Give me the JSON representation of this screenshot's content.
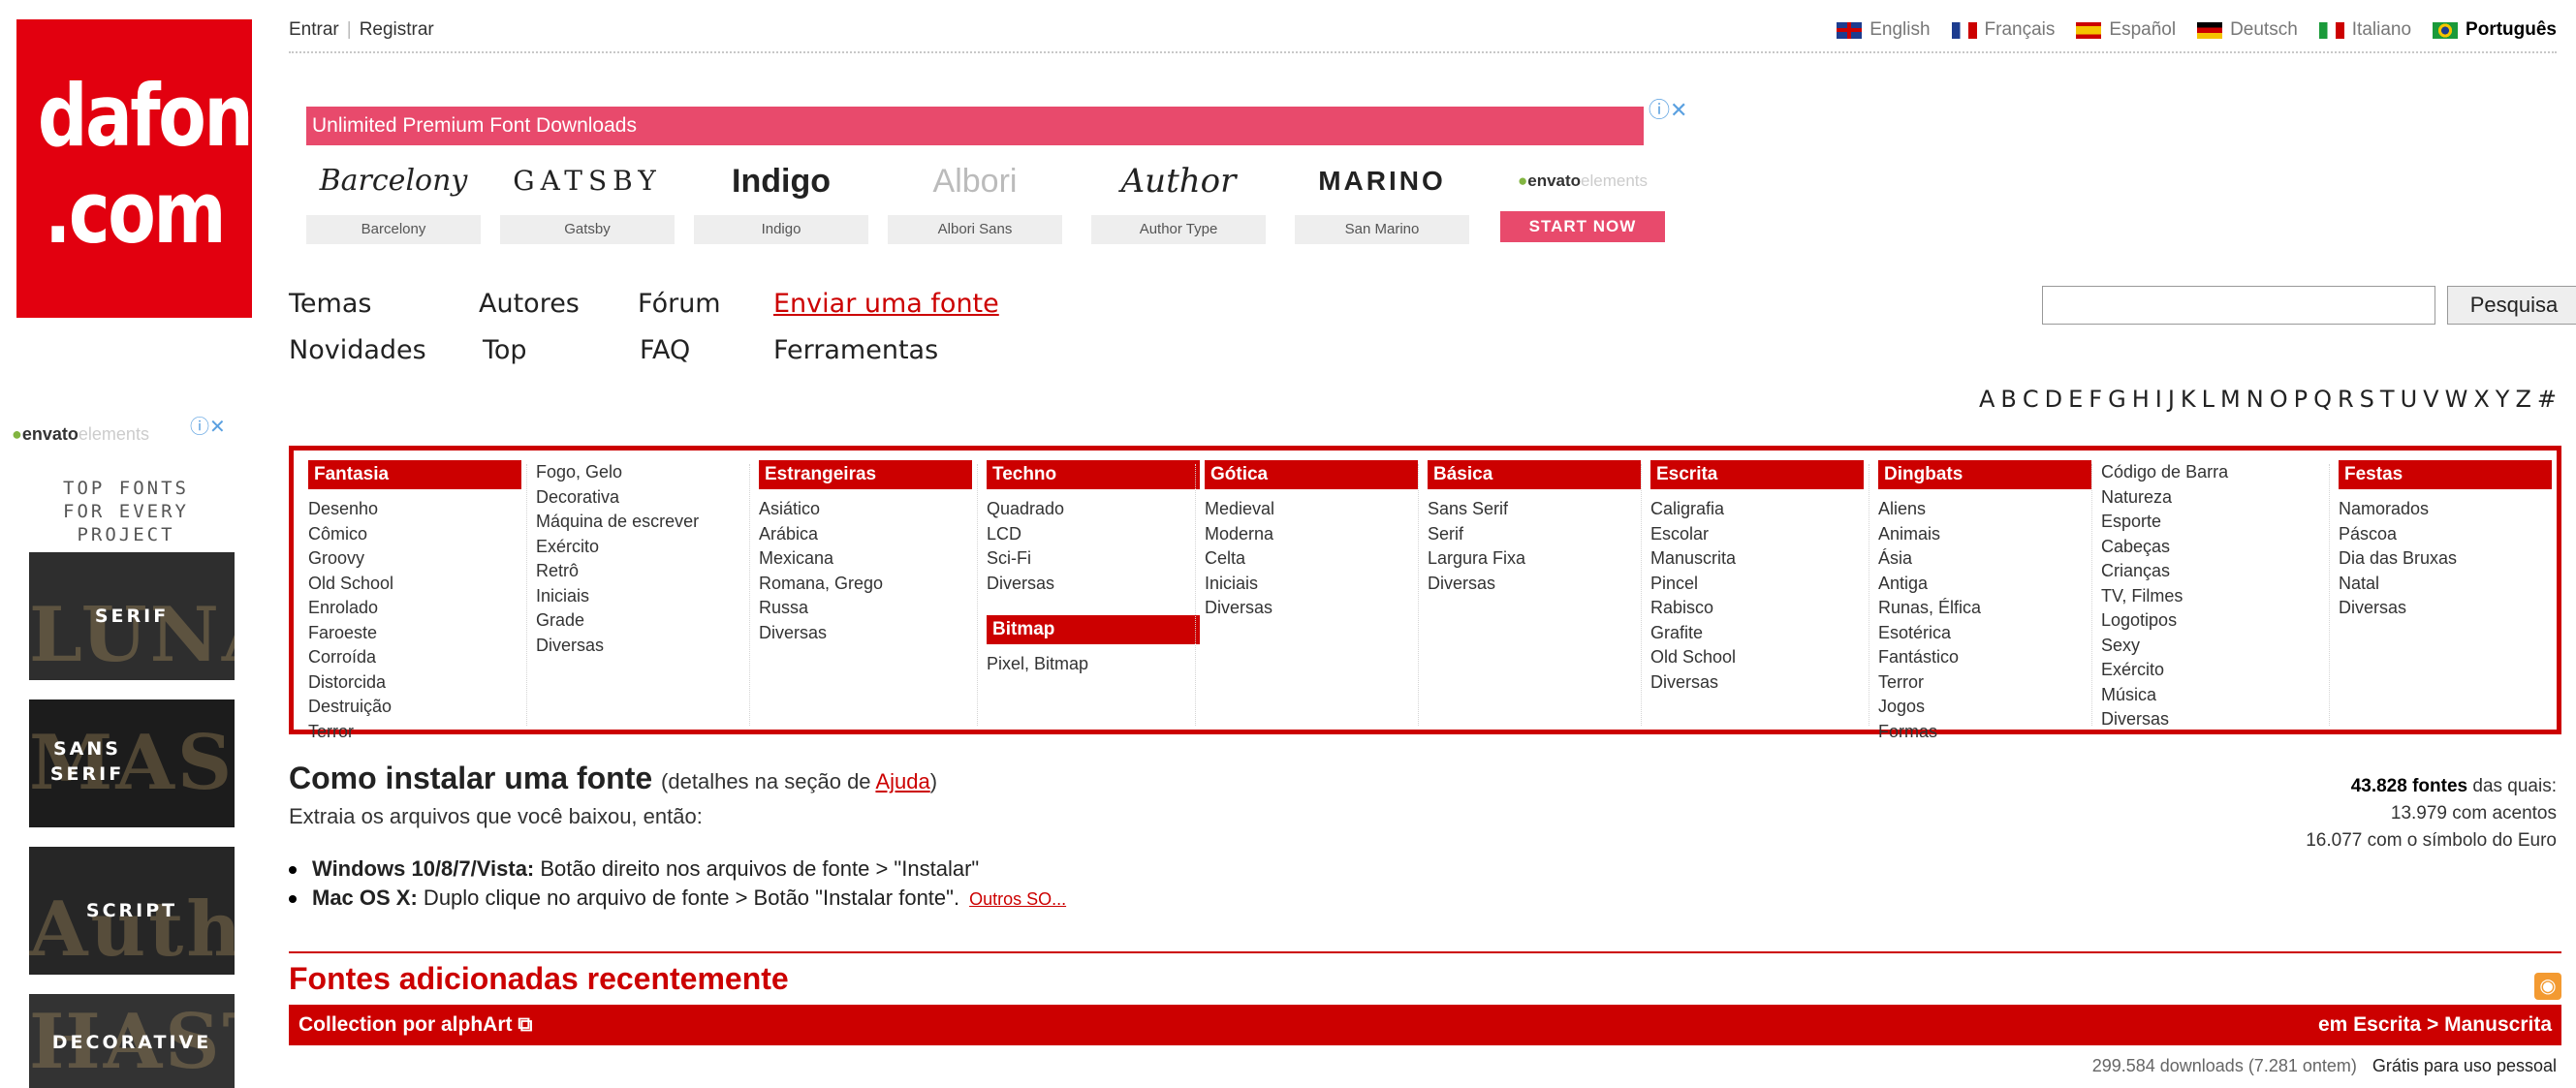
{
  "logo": {
    "line1": "dafont",
    "line2": ".com"
  },
  "side_ad": {
    "brand": "envato",
    "brand_suffix": "elements",
    "headline": [
      "TOP FONTS",
      "FOR EVERY",
      "PROJECT"
    ],
    "tiles": [
      {
        "label": "SERIF",
        "bg": "LUNA",
        "color": "#2e2e2e"
      },
      {
        "label": "SANS SERIF",
        "bg": "MASTER",
        "color": "#1c1c1c"
      },
      {
        "label": "SCRIPT",
        "bg": "Author",
        "color": "#262626"
      },
      {
        "label": "DECORATIVE",
        "bg": "HASTE",
        "color": "#333333"
      }
    ]
  },
  "topbar": {
    "login": "Entrar",
    "register": "Registrar",
    "languages": [
      {
        "label": "English",
        "active": false
      },
      {
        "label": "Français",
        "active": false
      },
      {
        "label": "Español",
        "active": false
      },
      {
        "label": "Deutsch",
        "active": false
      },
      {
        "label": "Italiano",
        "active": false
      },
      {
        "label": "Português",
        "active": true
      }
    ]
  },
  "top_ad": {
    "banner": "Unlimited Premium Font Downloads",
    "fonts": [
      {
        "sample": "Barcelony",
        "name": "Barcelony"
      },
      {
        "sample": "GATSBY",
        "name": "Gatsby"
      },
      {
        "sample": "Indigo",
        "name": "Indigo"
      },
      {
        "sample": "Albori",
        "name": "Albori Sans"
      },
      {
        "sample": "Author",
        "name": "Author Type"
      },
      {
        "sample": "MARINO",
        "name": "San Marino"
      }
    ],
    "brand": "envato",
    "brand_suffix": "elements",
    "cta": "START NOW"
  },
  "nav": {
    "row1": [
      "Temas",
      "Autores",
      "Fórum",
      "Enviar uma fonte"
    ],
    "row2": [
      "Novidades",
      "Top",
      "FAQ",
      "Ferramentas"
    ]
  },
  "search": {
    "button": "Pesquisa",
    "placeholder": ""
  },
  "alphabet": [
    "A",
    "B",
    "C",
    "D",
    "E",
    "F",
    "G",
    "H",
    "I",
    "J",
    "K",
    "L",
    "M",
    "N",
    "O",
    "P",
    "Q",
    "R",
    "S",
    "T",
    "U",
    "V",
    "W",
    "X",
    "Y",
    "Z",
    "#"
  ],
  "categories": [
    {
      "head": "Fantasia",
      "items": [
        "Desenho",
        "Cômico",
        "Groovy",
        "Old School",
        "Enrolado",
        "Faroeste",
        "Corroída",
        "Distorcida",
        "Destruição",
        "Terror"
      ]
    },
    {
      "head": "",
      "items": [
        "Fogo, Gelo",
        "Decorativa",
        "Máquina de escrever",
        "Exército",
        "Retrô",
        "Iniciais",
        "Grade",
        "Diversas"
      ]
    },
    {
      "head": "Estrangeiras",
      "items": [
        "Asiático",
        "Arábica",
        "Mexicana",
        "Romana, Grego",
        "Russa",
        "Diversas"
      ]
    },
    {
      "head": "Techno",
      "items": [
        "Quadrado",
        "LCD",
        "Sci-Fi",
        "Diversas"
      ],
      "head2": "Bitmap",
      "items2": [
        "Pixel, Bitmap"
      ]
    },
    {
      "head": "Gótica",
      "items": [
        "Medieval",
        "Moderna",
        "Celta",
        "Iniciais",
        "Diversas"
      ]
    },
    {
      "head": "Básica",
      "items": [
        "Sans Serif",
        "Serif",
        "Largura Fixa",
        "Diversas"
      ]
    },
    {
      "head": "Escrita",
      "items": [
        "Caligrafia",
        "Escolar",
        "Manuscrita",
        "Pincel",
        "Rabisco",
        "Grafite",
        "Old School",
        "Diversas"
      ]
    },
    {
      "head": "Dingbats",
      "items": [
        "Aliens",
        "Animais",
        "Ásia",
        "Antiga",
        "Runas, Élfica",
        "Esotérica",
        "Fantástico",
        "Terror",
        "Jogos",
        "Formas"
      ]
    },
    {
      "head": "",
      "items": [
        "Código de Barra",
        "Natureza",
        "Esporte",
        "Cabeças",
        "Crianças",
        "TV, Filmes",
        "Logotipos",
        "Sexy",
        "Exército",
        "Música",
        "Diversas"
      ]
    },
    {
      "head": "Festas",
      "items": [
        "Namorados",
        "Páscoa",
        "Dia das Bruxas",
        "Natal",
        "Diversas"
      ]
    }
  ],
  "install": {
    "title": "Como instalar uma fonte",
    "note_prefix": "(detalhes na seção de ",
    "note_link": "Ajuda",
    "note_suffix": ")",
    "lead": "Extraia os arquivos que você baixou, então:",
    "windows_bold": "Windows 10/8/7/Vista:",
    "windows_text": " Botão direito nos arquivos de fonte > \"Instalar\"",
    "mac_bold": "Mac OS X:",
    "mac_text": " Duplo clique no arquivo de fonte > Botão \"Instalar fonte\".",
    "more": "Outros SO..."
  },
  "stats": {
    "count": "43.828 fontes",
    "count_suffix": " das quais:",
    "accents": "13.979 com acentos",
    "euro": "16.077 com o símbolo do Euro"
  },
  "recent": {
    "title": "Fontes adicionadas recentemente",
    "font_name": "Collection por alphArt",
    "category": "em Escrita > Manuscrita",
    "downloads": "299.584 downloads (7.281 ontem)",
    "license": "Grátis para uso pessoal"
  }
}
